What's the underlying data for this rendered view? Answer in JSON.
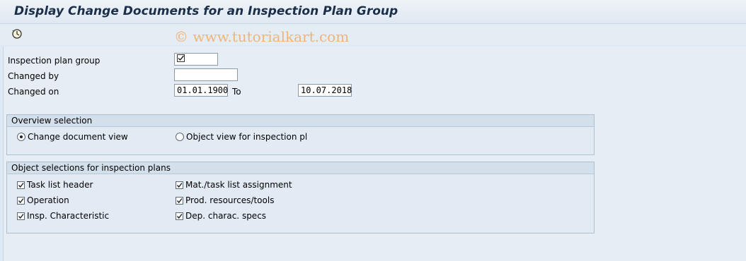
{
  "title": "Display Change Documents for an Inspection Plan Group",
  "watermark": "© www.tutorialkart.com",
  "toolbar": {
    "execute_icon": "execute-clock-icon"
  },
  "fields": {
    "inspection_plan_group": {
      "label": "Inspection plan group",
      "value": "",
      "icon": "checkbox-icon"
    },
    "changed_by": {
      "label": "Changed by",
      "value": ""
    },
    "changed_on": {
      "label": "Changed on",
      "from": "01.01.1900",
      "to_label": "To",
      "to": "10.07.2018"
    }
  },
  "overview": {
    "title": "Overview selection",
    "options": [
      {
        "label": "Change document view",
        "selected": true
      },
      {
        "label": "Object view for inspection pl",
        "selected": false
      }
    ]
  },
  "objects": {
    "title": "Object selections for inspection plans",
    "checkboxes": [
      {
        "label": "Task list header",
        "checked": true
      },
      {
        "label": "Operation",
        "checked": true
      },
      {
        "label": "Insp. Characteristic",
        "checked": true
      },
      {
        "label": "Mat./task list assignment",
        "checked": true
      },
      {
        "label": "Prod. resources/tools",
        "checked": true
      },
      {
        "label": "Dep. charac. specs",
        "checked": true
      }
    ]
  },
  "colors": {
    "title": "#1b2f4a",
    "background": "#dfe9f3",
    "watermark": "#f0b47a"
  }
}
